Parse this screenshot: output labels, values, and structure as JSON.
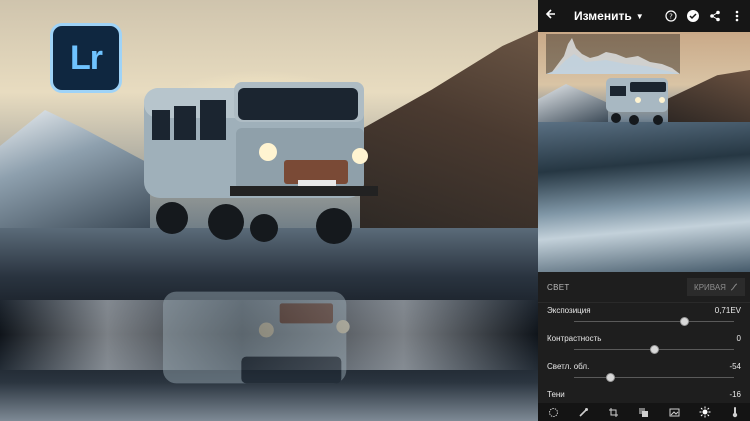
{
  "brand": {
    "logo_text": "Lr"
  },
  "topbar": {
    "title": "Изменить",
    "back_icon": "arrow-left-icon",
    "icons": [
      "help-icon",
      "check-icon",
      "share-icon",
      "more-vert-icon"
    ]
  },
  "panel": {
    "section_title": "СВЕТ",
    "curve_button": "КРИВАЯ",
    "sliders": [
      {
        "label": "Экспозиция",
        "value": "0,71EV",
        "position": 0.69
      },
      {
        "label": "Контрастность",
        "value": "0",
        "position": 0.5
      },
      {
        "label": "Светл. обл.",
        "value": "-54",
        "position": 0.23
      },
      {
        "label": "Тени",
        "value": "-16",
        "position": 0.42
      }
    ]
  },
  "bottombar": {
    "icons": [
      "presets-icon",
      "brush-icon",
      "crop-icon",
      "layers-icon",
      "image-icon",
      "light-icon",
      "temperature-icon"
    ]
  },
  "colors": {
    "accent": "#6fc3ff",
    "panel_bg": "#1e1e1e",
    "topbar_bg": "#161616"
  }
}
